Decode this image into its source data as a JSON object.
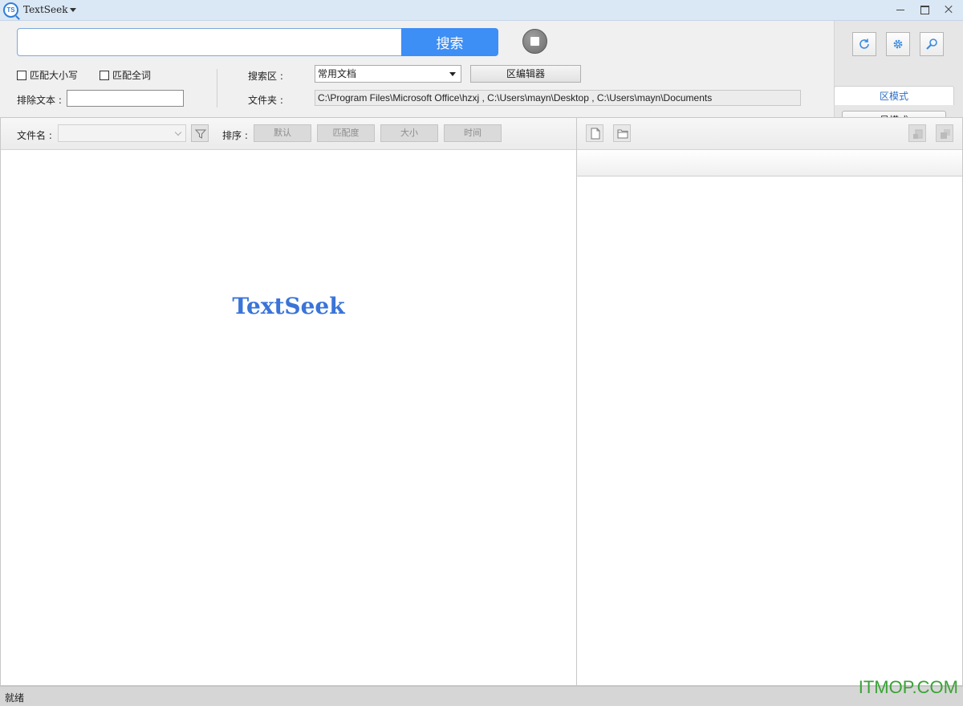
{
  "titlebar": {
    "app_title": "TextSeek",
    "logo_text": "TS"
  },
  "search": {
    "input_value": "",
    "button_label": "搜索"
  },
  "options": {
    "match_case_label": "匹配大小写",
    "match_whole_word_label": "匹配全词",
    "exclude_label": "排除文本 :",
    "exclude_value": ""
  },
  "area": {
    "label": "搜索区 :",
    "selected": "常用文档",
    "editor_button": "区编辑器",
    "folder_label": "文件夹 :",
    "folder_path": "C:\\Program Files\\Microsoft Office\\hzxj , C:\\Users\\mayn\\Desktop , C:\\Users\\mayn\\Documents"
  },
  "modes": {
    "area_mode": "区模式",
    "easy_mode": "易模式"
  },
  "filter": {
    "filename_label": "文件名 :",
    "sort_label": "排序 :",
    "sort_buttons": {
      "default": "默认",
      "match": "匹配度",
      "size": "大小",
      "time": "时间"
    }
  },
  "results": {
    "watermark": "TextSeek"
  },
  "status": {
    "text": "就绪",
    "site_mark": "ITMOP.COM"
  }
}
